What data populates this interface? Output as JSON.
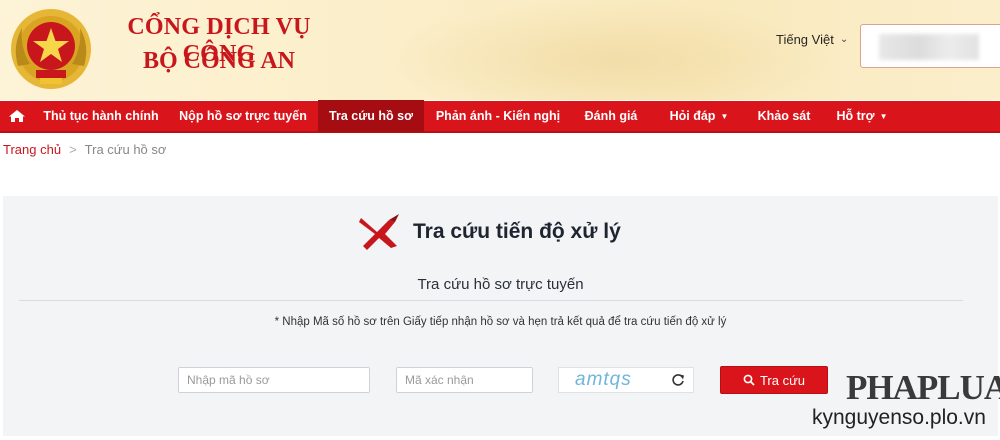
{
  "header": {
    "brand_line1": "CỔNG DỊCH VỤ CÔNG",
    "brand_line2": "BỘ CÔNG AN",
    "language": "Tiếng Việt",
    "colors": {
      "brand_red": "#c8161d",
      "header_bg": "#fbeec9"
    }
  },
  "nav": {
    "items": [
      {
        "label": "Thủ tục hành chính"
      },
      {
        "label": "Nộp hồ sơ trực tuyến"
      },
      {
        "label": "Tra cứu hồ sơ",
        "active": true
      },
      {
        "label": "Phản ánh - Kiến nghị"
      },
      {
        "label": "Đánh giá"
      },
      {
        "label": "Hỏi đáp",
        "dropdown": true
      },
      {
        "label": "Khảo sát"
      },
      {
        "label": "Hỗ trợ",
        "dropdown": true
      }
    ],
    "home_icon": "home-icon",
    "colors": {
      "bar": "#d9151b",
      "active": "#a50d12"
    }
  },
  "breadcrumb": {
    "home": "Trang chủ",
    "separator": ">",
    "current": "Tra cứu hồ sơ"
  },
  "lookup": {
    "title": "Tra cứu tiến độ xử lý",
    "subtitle": "Tra cứu hồ sơ trực tuyến",
    "note": "* Nhập Mã số hồ sơ trên Giấy tiếp nhận hồ sơ và hẹn trả kết quả để tra cứu tiến độ xử lý",
    "record_placeholder": "Nhập mã hồ sơ",
    "captcha_placeholder": "Mã xác nhận",
    "captcha_text": "amtqs",
    "search_label": "Tra cứu"
  },
  "watermark": {
    "brand": "PHAPLUAT",
    "url": "kynguyenso.plo.vn"
  }
}
